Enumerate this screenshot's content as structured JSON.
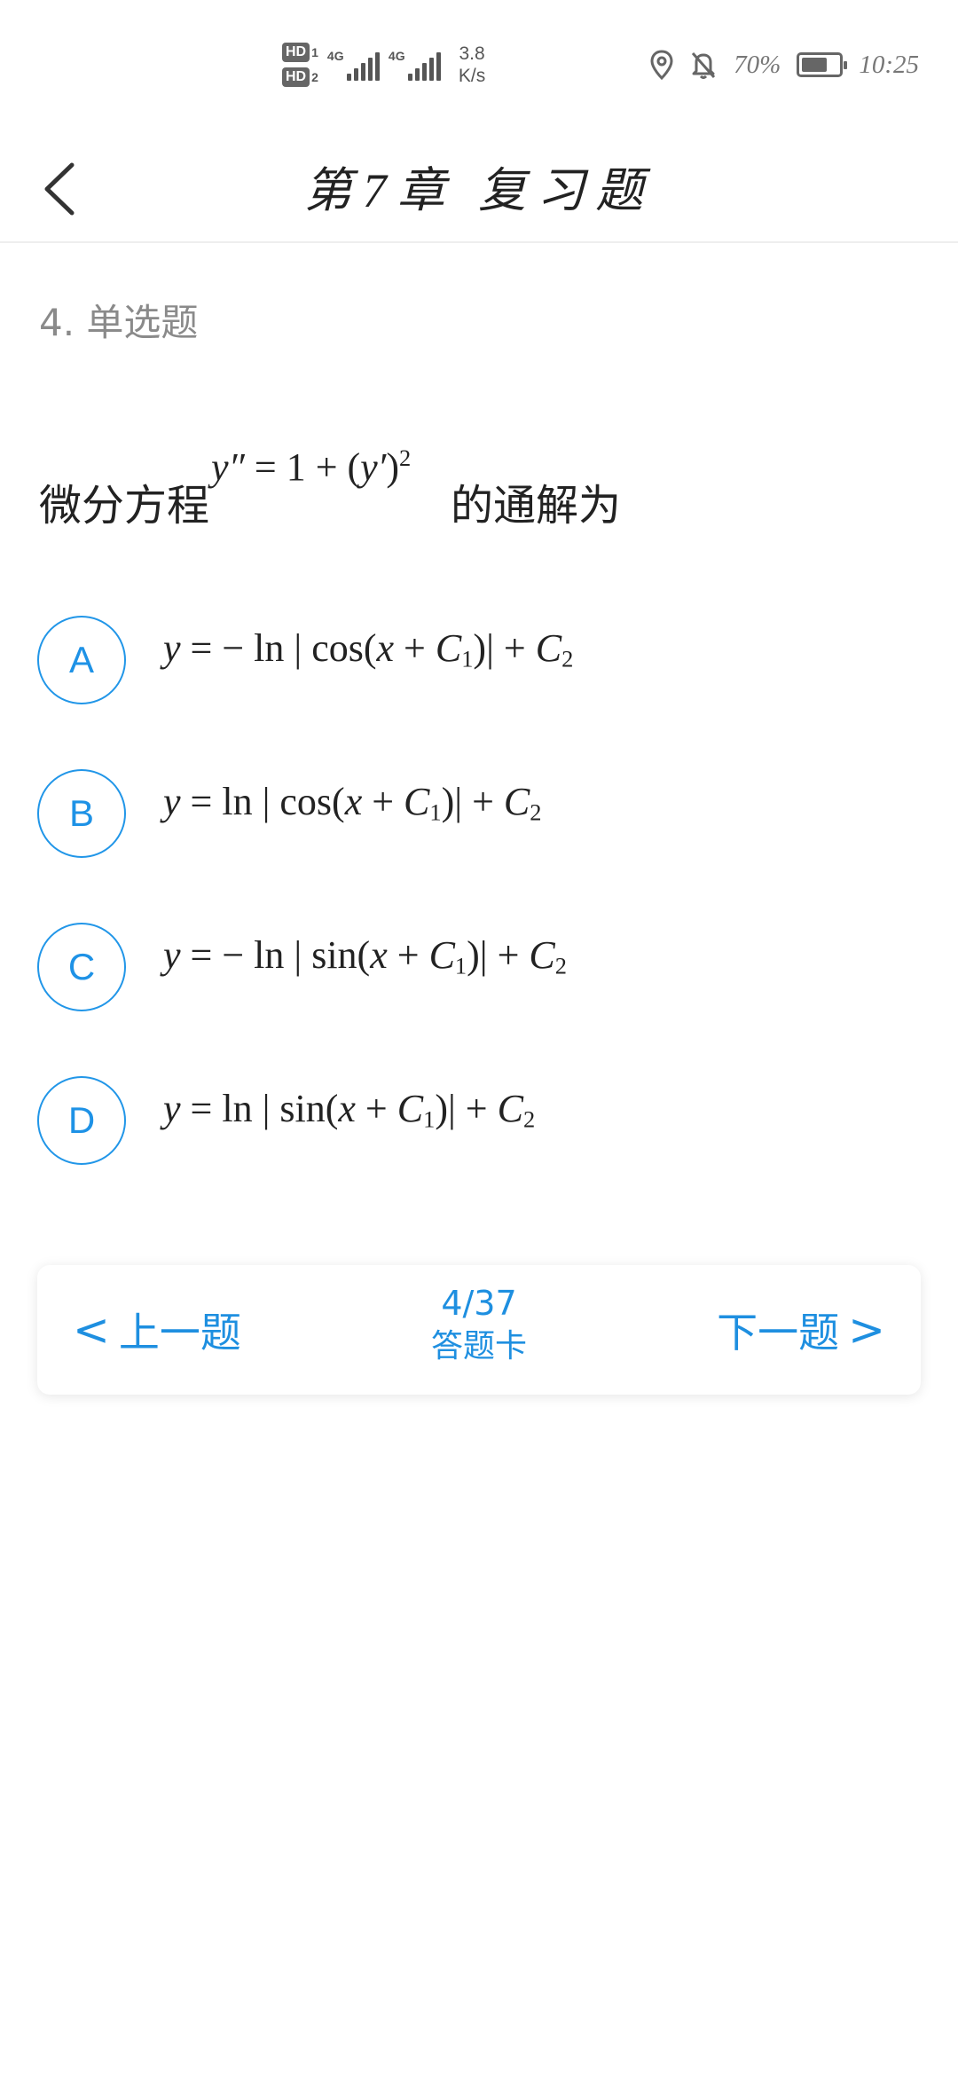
{
  "status_bar": {
    "hd1": "HD",
    "sim1": "1",
    "hd2": "HD",
    "sim2": "2",
    "net1": "4G",
    "net2": "4G",
    "speed_value": "3.8",
    "speed_unit": "K/s",
    "battery_pct": "70%",
    "battery_level": 0.7,
    "time": "10:25"
  },
  "header": {
    "title": "第7章 复习题"
  },
  "question": {
    "type_label": "4. 单选题",
    "prefix": "微分方程",
    "suffix": "的通解为"
  },
  "options": [
    {
      "letter": "A"
    },
    {
      "letter": "B"
    },
    {
      "letter": "C"
    },
    {
      "letter": "D"
    }
  ],
  "nav": {
    "prev_label": "上一题",
    "prev_chevron": "<",
    "next_label": "下一题",
    "next_chevron": ">",
    "progress": "4/37",
    "answer_card": "答题卡"
  },
  "colors": {
    "accent": "#1e8fe0",
    "title_text": "#222222",
    "muted_text": "#8a8a8a"
  }
}
